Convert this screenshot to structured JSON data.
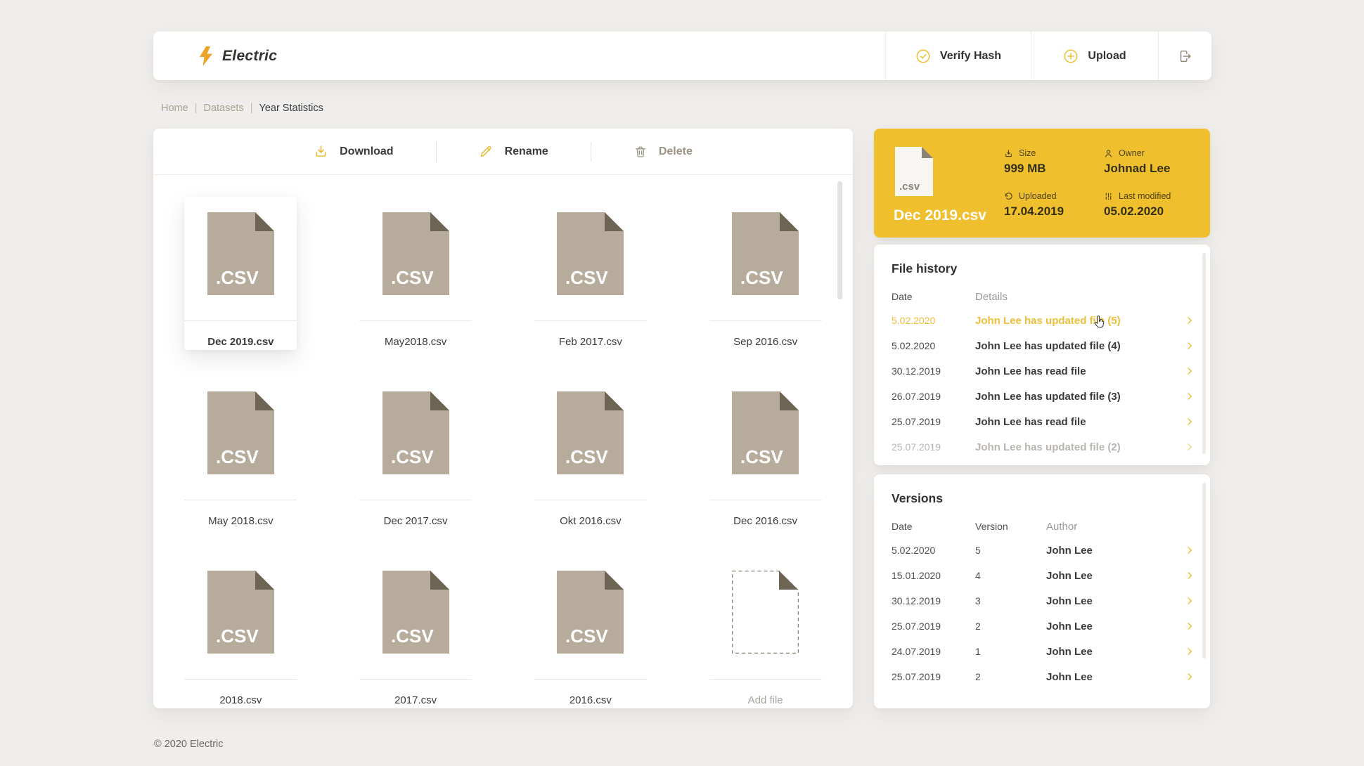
{
  "colors": {
    "accent_yellow": "#EFBF2D",
    "icon_yellow": "#E9B52B",
    "hover_yellow": "#EFBE3A",
    "file_icon_body": "#B7AC9B",
    "file_icon_fold": "#6E6454",
    "page_background": "#F0EEEC",
    "dark_text": "#3B3B3B",
    "muted_text": "#9B9894",
    "taupe": "#A89E8D"
  },
  "icons": {
    "logo": "lightning-bolt-icon",
    "verify_hash": "check-circle-icon",
    "upload": "plus-circle-icon",
    "sign_out": "sign-out-icon",
    "download": "download-arrow-icon",
    "rename": "pencil-icon",
    "delete": "trash-icon",
    "size": "download-arrow-icon",
    "owner": "person-icon",
    "uploaded": "history-arrow-icon",
    "last_modified": "sliders-icon",
    "row_link": "chevron-right-icon",
    "cursor": "hand-pointer-icon"
  },
  "brand": {
    "logo_text": "Electric"
  },
  "header": {
    "verify_hash_label": "Verify Hash",
    "upload_label": "Upload"
  },
  "breadcrumb": {
    "home": "Home",
    "datasets": "Datasets",
    "current": "Year Statistics",
    "sep": "|"
  },
  "toolbar": {
    "download_label": "Download",
    "rename_label": "Rename",
    "delete_label": "Delete"
  },
  "labels": {
    "csv_icon_text": ".CSV",
    "card_icon_text": ".csv"
  },
  "files": [
    {
      "label": "Dec 2019.csv",
      "selected": true
    },
    {
      "label": "May2018.csv"
    },
    {
      "label": "Feb 2017.csv"
    },
    {
      "label": "Sep 2016.csv"
    },
    {
      "label": "May 2018.csv"
    },
    {
      "label": "Dec 2017.csv"
    },
    {
      "label": "Okt 2016.csv"
    },
    {
      "label": "Dec 2016.csv"
    },
    {
      "label": "2018.csv"
    },
    {
      "label": "2017.csv"
    },
    {
      "label": "2016.csv"
    },
    {
      "label": "Add file",
      "type": "add"
    }
  ],
  "details_card": {
    "file_name": "Dec 2019.csv",
    "size_label": "Size",
    "size_value": "999 MB",
    "owner_label": "Owner",
    "owner_value": "Johnad Lee",
    "uploaded_label": "Uploaded",
    "uploaded_value": "17.04.2019",
    "modified_label": "Last modified",
    "modified_value": "05.02.2020"
  },
  "file_history": {
    "title": "File history",
    "columns": {
      "date": "Date",
      "details": "Details"
    },
    "rows": [
      {
        "date": "5.02.2020",
        "details": "John Lee has updated file (5)",
        "state": "hover"
      },
      {
        "date": "5.02.2020",
        "details": "John Lee has updated file (4)",
        "state": "normal"
      },
      {
        "date": "30.12.2019",
        "details": "John Lee has read file",
        "state": "normal"
      },
      {
        "date": "26.07.2019",
        "details": "John Lee has updated file (3)",
        "state": "normal"
      },
      {
        "date": "25.07.2019",
        "details": "John Lee has read file",
        "state": "normal"
      },
      {
        "date": "25.07.2019",
        "details": "John Lee has updated file (2)",
        "state": "faded"
      }
    ]
  },
  "versions": {
    "title": "Versions",
    "columns": {
      "date": "Date",
      "version": "Version",
      "author": "Author"
    },
    "rows": [
      {
        "date": "5.02.2020",
        "version": "5",
        "author": "John Lee"
      },
      {
        "date": "15.01.2020",
        "version": "4",
        "author": "John Lee"
      },
      {
        "date": "30.12.2019",
        "version": "3",
        "author": "John Lee"
      },
      {
        "date": "25.07.2019",
        "version": "2",
        "author": "John Lee"
      },
      {
        "date": "24.07.2019",
        "version": "1",
        "author": "John Lee"
      },
      {
        "date": "25.07.2019",
        "version": "2",
        "author": "John Lee"
      }
    ]
  },
  "footer": {
    "copyright": "© 2020 Electric"
  }
}
